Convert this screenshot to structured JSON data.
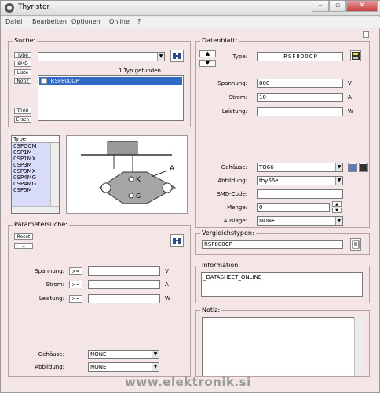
{
  "window": {
    "title": "Thyristor"
  },
  "menu": [
    "Datei",
    "Bearbeiten",
    "Optionen",
    "Online",
    "?"
  ],
  "suche": {
    "label": "Suche:",
    "buttons": [
      "Type",
      "SMD",
      "Liste",
      "Notiz"
    ],
    "ts_buttons": [
      "T100",
      "Ersch"
    ],
    "search_value": "",
    "result_count": "1 Typ gefunden",
    "results": [
      "RSF800CP"
    ]
  },
  "typelist": {
    "header": "Type",
    "items": [
      "0SPOCM",
      "0SP1M",
      "0SP1MX",
      "0SP3M",
      "0SP3MX",
      "0SP4MG",
      "0SP4MG",
      "0SP5M"
    ]
  },
  "package": {
    "labels": [
      "K",
      "G",
      "A"
    ]
  },
  "parametersuche": {
    "label": "Parametersuche:",
    "reset": "Reset",
    "rows": [
      {
        "label": "Spannung:",
        "op": ">=",
        "unit": "V"
      },
      {
        "label": "Strom:",
        "op": ">=",
        "unit": "A"
      },
      {
        "label": "Leistung:",
        "op": ">=",
        "unit": "W"
      }
    ],
    "selects": [
      {
        "label": "Gehäuse:",
        "value": "NONE"
      },
      {
        "label": "Abbildung:",
        "value": "NONE"
      }
    ]
  },
  "datenblatt": {
    "label": "Datenblatt:",
    "fields": [
      {
        "label": "Type:",
        "value": "RSF800CP"
      },
      {
        "label": "Spannung:",
        "value": "800",
        "unit": "V"
      },
      {
        "label": "Strom:",
        "value": "10",
        "unit": "A"
      },
      {
        "label": "Leistung:",
        "value": "",
        "unit": "W"
      }
    ],
    "lower": [
      {
        "label": "Gehäuse:",
        "value": "TO66"
      },
      {
        "label": "Abbildung:",
        "value": "thy66e"
      },
      {
        "label": "SMD-Code:",
        "value": ""
      },
      {
        "label": "Menge:",
        "value": "0"
      },
      {
        "label": "Auslage:",
        "value": "NONE"
      }
    ]
  },
  "vergleich": {
    "label": "Vergleichstypen:",
    "value": "RSF800CP"
  },
  "information": {
    "label": "Information:",
    "value": "_DATASHEET_ONLINE"
  },
  "notiz": {
    "label": "Notiz:",
    "value": ""
  },
  "watermark": "www.elektronik.si"
}
